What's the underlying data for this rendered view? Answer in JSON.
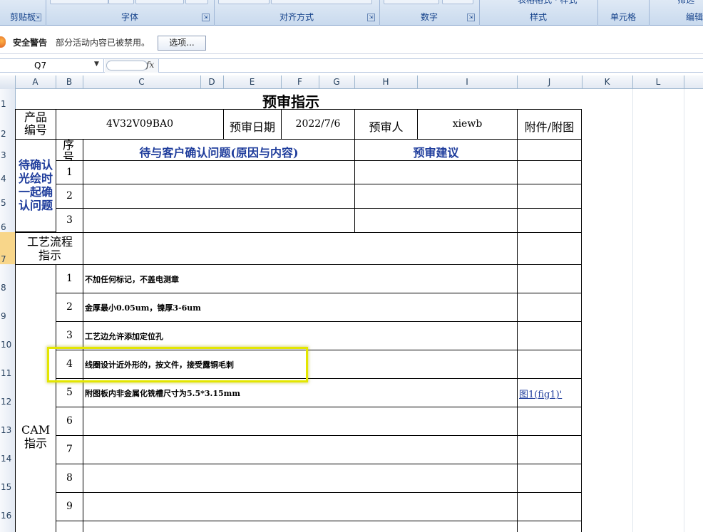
{
  "ribbon": {
    "groups": [
      {
        "label": "剪贴板",
        "launcher": "⇲"
      },
      {
        "label": "字体",
        "launcher": "⇲"
      },
      {
        "label": "对齐方式",
        "launcher": "⇲"
      },
      {
        "label": "数字",
        "launcher": "⇲"
      },
      {
        "label": "样式"
      },
      {
        "label": "单元格"
      },
      {
        "label": "编辑"
      }
    ],
    "partial_top_labels": {
      "style_buttons": "表格格式 · 样式",
      "filter": "筛选"
    }
  },
  "security_bar": {
    "title": "安全警告",
    "message": "部分活动内容已被禁用。",
    "options_button": "选项..."
  },
  "formula_bar": {
    "name_box": "Q7",
    "fx_label": "fx",
    "formula": ""
  },
  "columns": [
    "A",
    "B",
    "C",
    "D",
    "E",
    "F",
    "G",
    "H",
    "I",
    "J",
    "K",
    "L"
  ],
  "rows": [
    "1",
    "2",
    "3",
    "4",
    "5",
    "6",
    "7",
    "8",
    "9",
    "10",
    "11",
    "12",
    "13",
    "14",
    "15",
    "16"
  ],
  "sheet": {
    "title": "预审指示",
    "product_label": "产品编号",
    "product_no": "4V32V09BA0",
    "date_label": "预审日期",
    "date_value": "2022/7/6",
    "reviewer_label": "预审人",
    "reviewer_value": "xiewb",
    "attach_label": "附件/附图",
    "pending_label": "待确认光绘时一起确认问题",
    "seq_label": "序号",
    "issue_header": "待与客户确认问题(原因与内容)",
    "suggest_header": "预审建议",
    "pending_rows": [
      "1",
      "2",
      "3"
    ],
    "process_label": "工艺流程指示",
    "cam_label": "CAM指示",
    "cam_rows": [
      {
        "no": "1",
        "text": "不加任何标记，不盖电测章",
        "attach": ""
      },
      {
        "no": "2",
        "text": "金厚最小0.05um，镍厚3-6um",
        "attach": ""
      },
      {
        "no": "3",
        "text": "工艺边允许添加定位孔",
        "attach": ""
      },
      {
        "no": "4",
        "text": "线圈设计近外形的，按文件，接受露铜毛刺",
        "attach": ""
      },
      {
        "no": "5",
        "text": "附图板内非金属化铣槽尺寸为5.5*3.15mm",
        "attach": "图1(fig1)'"
      },
      {
        "no": "6",
        "text": "",
        "attach": ""
      },
      {
        "no": "7",
        "text": "",
        "attach": ""
      },
      {
        "no": "8",
        "text": "",
        "attach": ""
      },
      {
        "no": "9",
        "text": "",
        "attach": ""
      }
    ]
  }
}
